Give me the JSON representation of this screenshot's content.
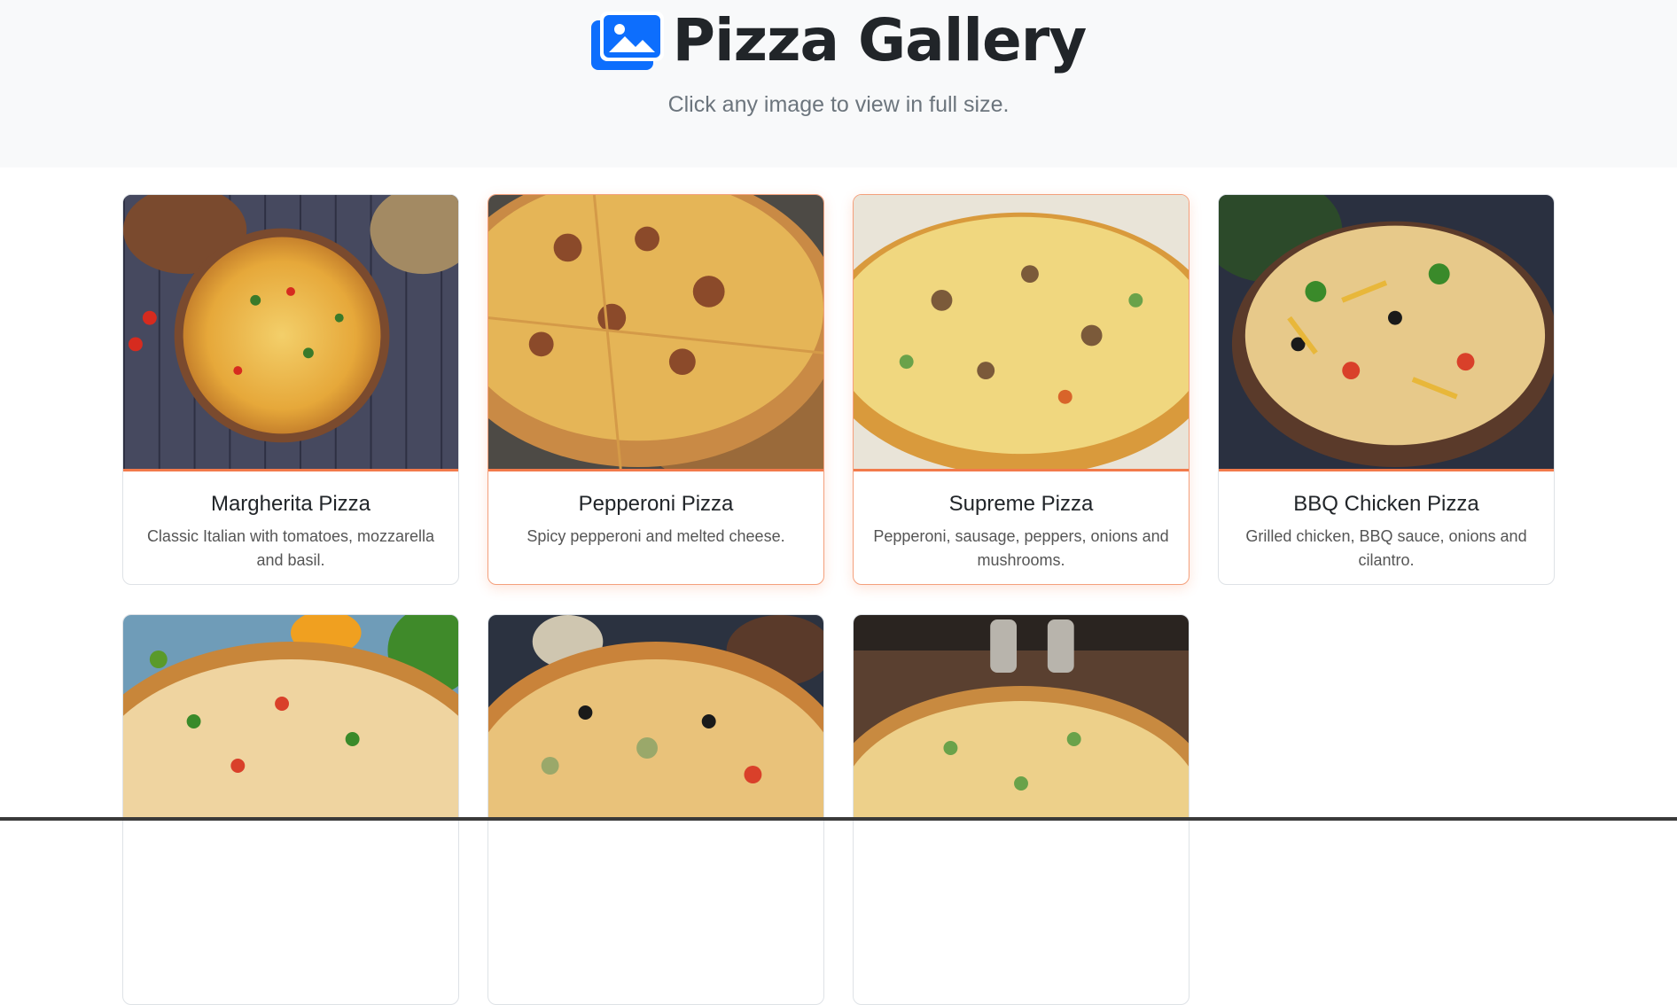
{
  "header": {
    "title": "Pizza Gallery",
    "subtitle": "Click any image to view in full size.",
    "icon": "images-icon",
    "accent": "#0d6efd"
  },
  "cards": [
    {
      "name": "Margherita Pizza",
      "desc": "Classic Italian with tomatoes, mozzarella and basil."
    },
    {
      "name": "Pepperoni Pizza",
      "desc": "Spicy pepperoni and melted cheese."
    },
    {
      "name": "Supreme Pizza",
      "desc": "Pepperoni, sausage, peppers, onions and mushrooms."
    },
    {
      "name": "BBQ Chicken Pizza",
      "desc": "Grilled chicken, BBQ sauce, onions and cilantro."
    }
  ],
  "colors": {
    "image_border": "#f27a4b",
    "hover_border": "#f4a07c"
  }
}
